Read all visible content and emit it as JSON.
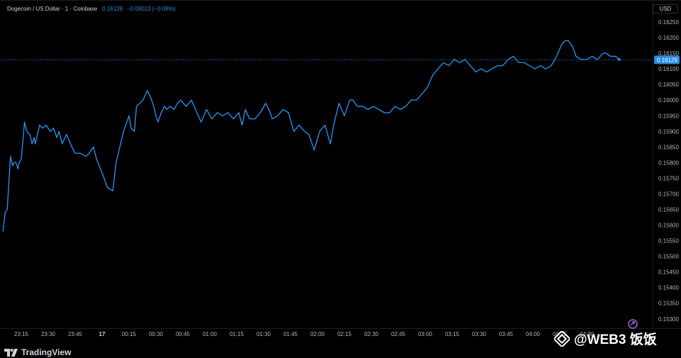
{
  "header": {
    "symbol": "Dogecoin / US Dollar · 1 · Coinbase",
    "last_price": "0.16129",
    "change": "−0.00013 (−0.08%)"
  },
  "axis_unit": "USD",
  "branding": {
    "logo_text": "TradingView",
    "watermark_text": "@WEB3 饭饭"
  },
  "colors": {
    "line": "#2a8ce0",
    "price_tag": "#2a8ce0",
    "background": "#000000",
    "axis_text": "#b2b5be"
  },
  "chart_data": {
    "type": "line",
    "title": "",
    "xlabel": "",
    "ylabel": "",
    "ylim": [
      0.1527,
      0.16275
    ],
    "x_ticks": [
      "23:15",
      "23:30",
      "23:45",
      "17",
      "00:15",
      "00:30",
      "00:45",
      "01:00",
      "01:15",
      "01:30",
      "01:45",
      "02:00",
      "02:15",
      "02:30",
      "02:45",
      "03:00",
      "03:15",
      "03:30",
      "03:45",
      "04:00",
      "04:15",
      "04:30"
    ],
    "y_ticks": [
      "0.16250",
      "0.16200",
      "0.16150",
      "0.16100",
      "0.16050",
      "0.16000",
      "0.15950",
      "0.15900",
      "0.15850",
      "0.15800",
      "0.15750",
      "0.15700",
      "0.15650",
      "0.15600",
      "0.15550",
      "0.15500",
      "0.15450",
      "0.15400",
      "0.15350",
      "0.15300"
    ],
    "current_price": "0.16129",
    "grid": false,
    "series": [
      {
        "points": [
          [
            23.08,
            0.1558
          ],
          [
            23.1,
            0.1564
          ],
          [
            23.12,
            0.1565
          ],
          [
            23.13,
            0.1571
          ],
          [
            23.15,
            0.1582
          ],
          [
            23.17,
            0.1579
          ],
          [
            23.18,
            0.158
          ],
          [
            23.2,
            0.158
          ],
          [
            23.22,
            0.1578
          ],
          [
            23.23,
            0.158
          ],
          [
            23.25,
            0.1581
          ],
          [
            23.28,
            0.1593
          ],
          [
            23.3,
            0.159
          ],
          [
            23.33,
            0.1589
          ],
          [
            23.35,
            0.1586
          ],
          [
            23.37,
            0.1588
          ],
          [
            23.38,
            0.1586
          ],
          [
            23.42,
            0.1592
          ],
          [
            23.45,
            0.1591
          ],
          [
            23.48,
            0.1592
          ],
          [
            23.52,
            0.159
          ],
          [
            23.55,
            0.1591
          ],
          [
            23.58,
            0.1588
          ],
          [
            23.6,
            0.159
          ],
          [
            23.63,
            0.1586
          ],
          [
            23.67,
            0.1589
          ],
          [
            23.72,
            0.1585
          ],
          [
            23.75,
            0.1583
          ],
          [
            23.8,
            0.1583
          ],
          [
            23.85,
            0.1582
          ],
          [
            23.88,
            0.1583
          ],
          [
            23.92,
            0.1585
          ],
          [
            23.95,
            0.1581
          ],
          [
            24.02,
            0.1575
          ],
          [
            24.05,
            0.1572
          ],
          [
            24.1,
            0.1571
          ],
          [
            24.13,
            0.158
          ],
          [
            24.2,
            0.159
          ],
          [
            24.25,
            0.1595
          ],
          [
            24.27,
            0.1591
          ],
          [
            24.3,
            0.159
          ],
          [
            24.32,
            0.1598
          ],
          [
            24.35,
            0.1599
          ],
          [
            24.38,
            0.16
          ],
          [
            24.42,
            0.1603
          ],
          [
            24.45,
            0.1601
          ],
          [
            24.48,
            0.1598
          ],
          [
            24.5,
            0.1595
          ],
          [
            24.52,
            0.1593
          ],
          [
            24.55,
            0.1596
          ],
          [
            24.58,
            0.1598
          ],
          [
            24.6,
            0.1597
          ],
          [
            24.63,
            0.1598
          ],
          [
            24.67,
            0.1597
          ],
          [
            24.7,
            0.1599
          ],
          [
            24.73,
            0.16
          ],
          [
            24.78,
            0.1598
          ],
          [
            24.83,
            0.16
          ],
          [
            24.88,
            0.1596
          ],
          [
            24.92,
            0.1593
          ],
          [
            24.97,
            0.1597
          ],
          [
            25.02,
            0.1594
          ],
          [
            25.07,
            0.1596
          ],
          [
            25.12,
            0.1595
          ],
          [
            25.17,
            0.1596
          ],
          [
            25.22,
            0.1594
          ],
          [
            25.27,
            0.1596
          ],
          [
            25.3,
            0.1592
          ],
          [
            25.33,
            0.1597
          ],
          [
            25.37,
            0.1594
          ],
          [
            25.42,
            0.1594
          ],
          [
            25.47,
            0.1596
          ],
          [
            25.52,
            0.1599
          ],
          [
            25.55,
            0.1597
          ],
          [
            25.58,
            0.1594
          ],
          [
            25.63,
            0.1595
          ],
          [
            25.68,
            0.1597
          ],
          [
            25.73,
            0.1596
          ],
          [
            25.78,
            0.159
          ],
          [
            25.83,
            0.1592
          ],
          [
            25.88,
            0.159
          ],
          [
            25.92,
            0.1589
          ],
          [
            25.97,
            0.1584
          ],
          [
            26.02,
            0.159
          ],
          [
            26.07,
            0.1592
          ],
          [
            26.12,
            0.1586
          ],
          [
            26.15,
            0.1592
          ],
          [
            26.2,
            0.1599
          ],
          [
            26.25,
            0.1595
          ],
          [
            26.3,
            0.16
          ],
          [
            26.33,
            0.16
          ],
          [
            26.37,
            0.1598
          ],
          [
            26.42,
            0.1598
          ],
          [
            26.47,
            0.1597
          ],
          [
            26.52,
            0.1598
          ],
          [
            26.57,
            0.1597
          ],
          [
            26.62,
            0.1596
          ],
          [
            26.67,
            0.1596
          ],
          [
            26.72,
            0.1598
          ],
          [
            26.77,
            0.1597
          ],
          [
            26.82,
            0.1598
          ],
          [
            26.87,
            0.16
          ],
          [
            26.92,
            0.16
          ],
          [
            26.97,
            0.1602
          ],
          [
            27.02,
            0.1604
          ],
          [
            27.07,
            0.1608
          ],
          [
            27.12,
            0.161
          ],
          [
            27.17,
            0.1612
          ],
          [
            27.22,
            0.1611
          ],
          [
            27.27,
            0.1613
          ],
          [
            27.32,
            0.1612
          ],
          [
            27.37,
            0.1613
          ],
          [
            27.42,
            0.1611
          ],
          [
            27.47,
            0.1609
          ],
          [
            27.52,
            0.161
          ],
          [
            27.57,
            0.1609
          ],
          [
            27.62,
            0.161
          ],
          [
            27.67,
            0.1611
          ],
          [
            27.72,
            0.1611
          ],
          [
            27.77,
            0.1613
          ],
          [
            27.82,
            0.1614
          ],
          [
            27.87,
            0.1612
          ],
          [
            27.92,
            0.1612
          ],
          [
            27.97,
            0.1611
          ],
          [
            28.02,
            0.161
          ],
          [
            28.07,
            0.1611
          ],
          [
            28.12,
            0.161
          ],
          [
            28.17,
            0.1611
          ],
          [
            28.22,
            0.1614
          ],
          [
            28.27,
            0.1618
          ],
          [
            28.3,
            0.1619
          ],
          [
            28.33,
            0.1619
          ],
          [
            28.37,
            0.1617
          ],
          [
            28.4,
            0.1614
          ],
          [
            28.45,
            0.1613
          ],
          [
            28.5,
            0.1613
          ],
          [
            28.55,
            0.1614
          ],
          [
            28.6,
            0.1613
          ],
          [
            28.65,
            0.1615
          ],
          [
            28.68,
            0.1615
          ],
          [
            28.72,
            0.1614
          ],
          [
            28.77,
            0.1614
          ],
          [
            28.8,
            0.1613
          ]
        ]
      }
    ]
  }
}
